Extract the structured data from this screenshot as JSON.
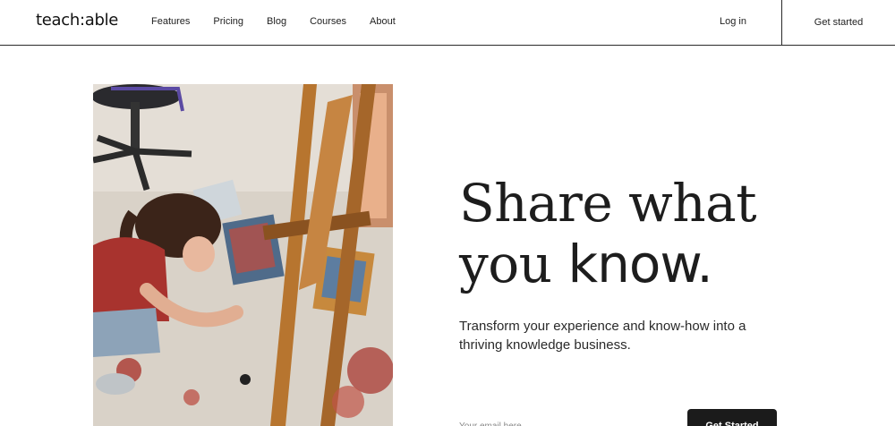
{
  "header": {
    "logo": "teach:able",
    "nav": [
      "Features",
      "Pricing",
      "Blog",
      "Courses",
      "About"
    ],
    "login": "Log in",
    "get_started": "Get started"
  },
  "hero": {
    "image_alt": "Artist painting on the floor beside an easel",
    "headline_line1": "Share what",
    "headline_line2_light": "you ",
    "headline_line2_bold": "know.",
    "subtitle": "Transform your experience and know-how into a thriving knowledge business.",
    "email_placeholder": "Your email here",
    "cta": "Get Started"
  }
}
